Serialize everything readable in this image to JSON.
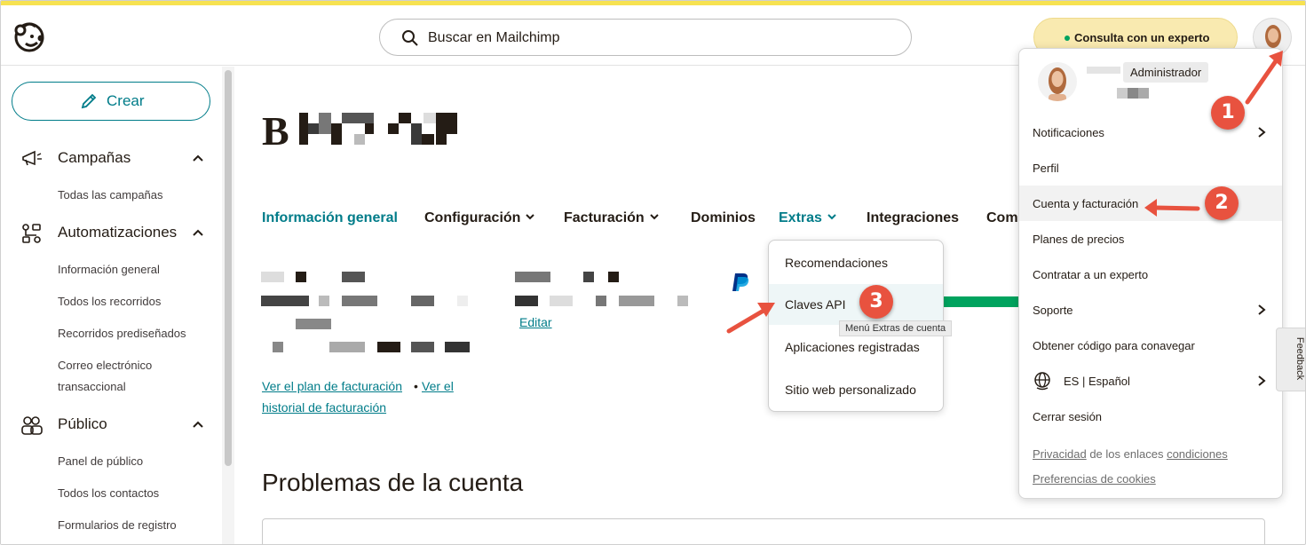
{
  "header": {
    "search_placeholder": "Buscar en Mailchimp",
    "expert_label": "Consulta con un experto"
  },
  "sidebar": {
    "create_label": "Crear",
    "sections": [
      {
        "label": "Campañas",
        "icon": "megaphone-icon",
        "items": [
          "Todas las campañas"
        ]
      },
      {
        "label": "Automatizaciones",
        "icon": "automation-icon",
        "items": [
          "Información general",
          "Todos los recorridos",
          "Recorridos prediseñados",
          "Correo electrónico",
          "transaccional"
        ]
      },
      {
        "label": "Público",
        "icon": "audience-icon",
        "items": [
          "Panel de público",
          "Todos los contactos",
          "Formularios de registro"
        ]
      }
    ]
  },
  "main": {
    "brand_initial": "B",
    "tabs": [
      "Información general",
      "Configuración",
      "Facturación",
      "Dominios",
      "Extras",
      "Integraciones",
      "Com"
    ],
    "edit_link": "Editar",
    "billing_links": {
      "plan": "Ver el plan de facturación",
      "separator": "•",
      "history_a": "Ver el",
      "history_b": "historial de facturación"
    },
    "problems_title": "Problemas de la cuenta"
  },
  "extras_menu": {
    "items": [
      "Recomendaciones",
      "Claves API",
      "Aplicaciones registradas",
      "Sitio web personalizado"
    ],
    "tooltip": "Menú Extras de cuenta"
  },
  "account_menu": {
    "role": "Administrador",
    "items": [
      "Notificaciones",
      "Perfil",
      "Cuenta y facturación",
      "Planes de precios",
      "Contratar a un experto",
      "Soporte",
      "Obtener código para conavegar",
      "ES | Español",
      "Cerrar sesión"
    ],
    "footer": {
      "privacy": "Privacidad",
      "mid": "de los enlaces",
      "terms": "condiciones",
      "cookies": "Preferencias de cookies"
    }
  },
  "feedback_label": "Feedback",
  "steps": [
    "1",
    "2",
    "3"
  ],
  "colors": {
    "accent": "#007c89",
    "highlight_yellow": "#f7e251",
    "annotation_red": "#e8523f",
    "success_green": "#00a35e"
  }
}
